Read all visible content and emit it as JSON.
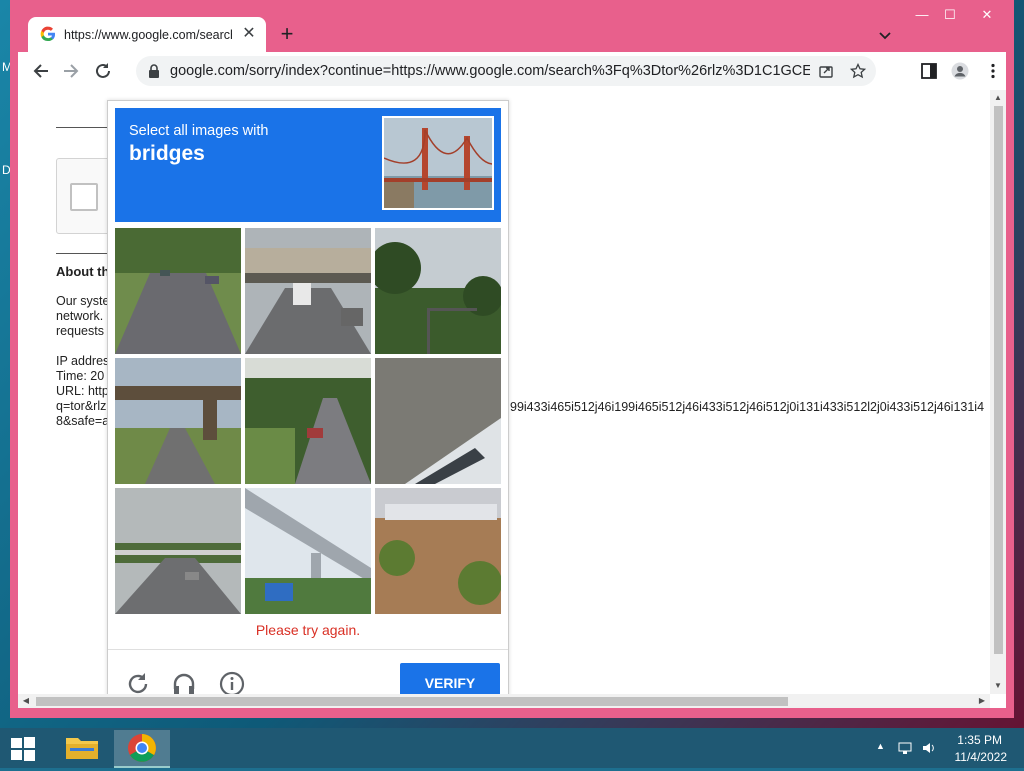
{
  "desktop": {
    "letters": [
      "M",
      "D"
    ]
  },
  "tab": {
    "title": "https://www.google.com/search?q"
  },
  "address_bar": {
    "url": "google.com/sorry/index?continue=https://www.google.com/search%3Fq%3Dtor%26rlz%3D1C1GCEA_enU..."
  },
  "page": {
    "about_title": "About th",
    "para1": [
      "Our syste",
      "network.",
      "requests"
    ],
    "para2": [
      "IP addres",
      "Time: 20",
      "URL: http",
      "q=tor&rlz",
      "8&safe=a"
    ],
    "long_text": "99i433i465i512j46i199i465i512j46i433i512j46i512j0i131i433i512l2j0i433i512j46i131i4"
  },
  "recaptcha": {
    "instruction": "Select all images with",
    "target": "bridges",
    "error": "Please try again.",
    "verify_label": "VERIFY",
    "tiles": [
      {
        "name": "tile-1",
        "scene": "tree-lined road with parked cars"
      },
      {
        "name": "tile-2",
        "scene": "highway under overpass with truck"
      },
      {
        "name": "tile-3",
        "scene": "trees and traffic signal"
      },
      {
        "name": "tile-4",
        "scene": "road passing under bridge"
      },
      {
        "name": "tile-5",
        "scene": "narrow road with car among trees"
      },
      {
        "name": "tile-6",
        "scene": "close-up of vehicle"
      },
      {
        "name": "tile-7",
        "scene": "highway with distant overpass"
      },
      {
        "name": "tile-8",
        "scene": "elevated rail bridge"
      },
      {
        "name": "tile-9",
        "scene": "truck on distant road"
      }
    ]
  },
  "taskbar": {
    "time": "1:35 PM",
    "date": "11/4/2022"
  },
  "colors": {
    "window_frame": "#e8608c",
    "recaptcha_blue": "#1a73e8",
    "error_red": "#d93025"
  }
}
